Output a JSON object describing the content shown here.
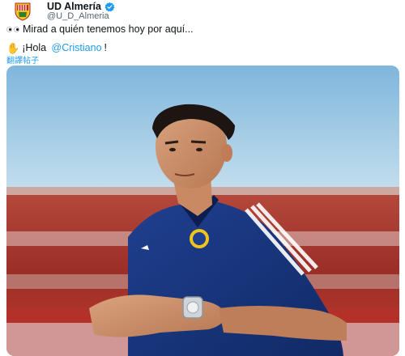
{
  "tweet": {
    "author": {
      "display_name": "UD Almería",
      "handle": "@U_D_Almeria",
      "avatar_icon": "club-crest-icon",
      "verified_icon": "verified-badge-icon"
    },
    "text_line1": "Mirad a quién tenemos hoy por aquí...",
    "text_line2_prefix": "¡Hola ",
    "mention": "@Cristiano",
    "text_line2_suffix": "!",
    "translate_label": "翻譯帖子",
    "colors": {
      "link": "#1d9bf0",
      "verified": "#1d9bf0",
      "secondary_text": "#536471"
    },
    "media": {
      "description_icon": "photo-player-in-stadium"
    }
  }
}
